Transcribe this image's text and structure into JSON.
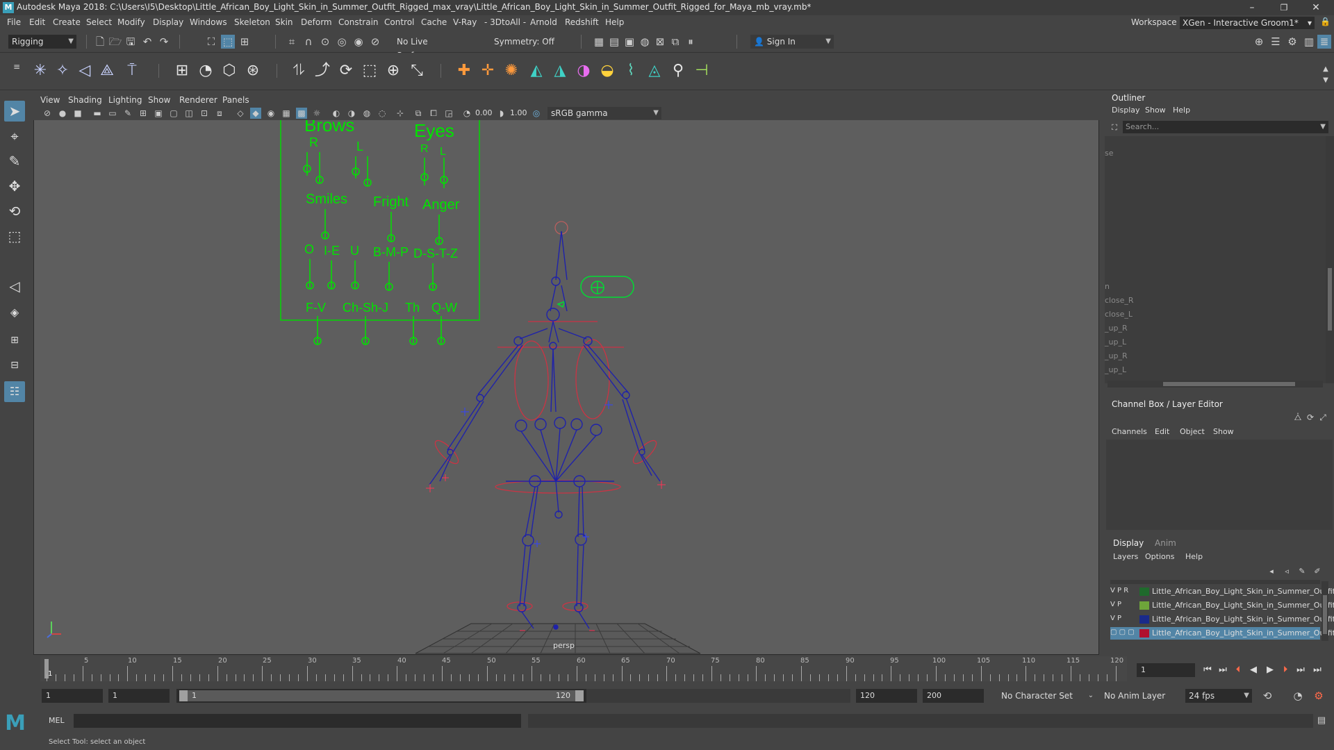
{
  "window": {
    "title": "Autodesk Maya 2018: C:\\Users\\I5\\Desktop\\Little_African_Boy_Light_Skin_in_Summer_Outfit_Rigged_max_vray\\Little_African_Boy_Light_Skin_in_Summer_Outfit_Rigged_for_Maya_mb_vray.mb*",
    "logo": "M",
    "minimize": "–",
    "maximize": "❐",
    "close": "✕"
  },
  "menubar": {
    "items": [
      "File",
      "Edit",
      "Create",
      "Select",
      "Modify",
      "Display",
      "Windows",
      "Skeleton",
      "Skin",
      "Deform",
      "Constrain",
      "Control",
      "Cache",
      "V-Ray",
      "- 3DtoAll -",
      "Arnold",
      "Redshift",
      "Help"
    ],
    "workspace_label": "Workspace :",
    "workspace_value": "XGen - Interactive Groom1*"
  },
  "statusline": {
    "menuset": "Rigging",
    "live_surface": "No Live Surface",
    "symmetry": "Symmetry: Off",
    "sign_in": "Sign In"
  },
  "viewport": {
    "menus": [
      "View",
      "Shading",
      "Lighting",
      "Show",
      "Renderer",
      "Panels"
    ],
    "exposure": "0.00",
    "gamma": "1.00",
    "color_space": "sRGB gamma",
    "camera_label": "persp"
  },
  "face_controls": {
    "brows": "Brows",
    "eyes": "Eyes",
    "brows_r": "R",
    "brows_l": "L",
    "eyes_r": "R",
    "eyes_l": "L",
    "smiles": "Smiles",
    "fright": "Fright",
    "anger": "Anger",
    "o": "O",
    "i_e": "I-E",
    "u": "U",
    "bmp": "B-M-P",
    "dstz": "D-S-T-Z",
    "fv": "F-V",
    "chshj": "Ch-Sh-J",
    "th": "Th",
    "qw": "Q-W"
  },
  "outliner": {
    "title": "Outliner",
    "menus": [
      "Display",
      "Show",
      "Help"
    ],
    "search_placeholder": "Search...",
    "items": [
      "se",
      "n",
      "close_R",
      "close_L",
      "_up_R",
      "_up_L",
      "_up_R",
      "_up_L"
    ]
  },
  "channelbox": {
    "title": "Channel Box / Layer Editor",
    "menus": [
      "Channels",
      "Edit",
      "Object",
      "Show"
    ]
  },
  "layereditor": {
    "tabs": [
      "Display",
      "Anim"
    ],
    "menus": [
      "Layers",
      "Options",
      "Help"
    ],
    "layers": [
      {
        "v": "V",
        "p": "P",
        "r": "R",
        "color": "#1f6a2c",
        "name": "Little_African_Boy_Light_Skin_in_Summer_Outfit"
      },
      {
        "v": "V",
        "p": "P",
        "r": "",
        "color": "#6ea53a",
        "name": "Little_African_Boy_Light_Skin_in_Summer_Outfit"
      },
      {
        "v": "V",
        "p": "P",
        "r": "",
        "color": "#1a2a8a",
        "name": "Little_African_Boy_Light_Skin_in_Summer_Outfit"
      },
      {
        "v": "",
        "p": "",
        "r": "",
        "color": "#b0102e",
        "name": "Little_African_Boy_Light_Skin_in_Summer_Outfit"
      }
    ]
  },
  "timeslider": {
    "labels": [
      "1",
      "5",
      "10",
      "15",
      "20",
      "25",
      "30",
      "35",
      "40",
      "45",
      "50",
      "55",
      "60",
      "65",
      "70",
      "75",
      "80",
      "85",
      "90",
      "95",
      "100",
      "105",
      "110",
      "115",
      "120"
    ],
    "current_frame": "1"
  },
  "range": {
    "start": "1",
    "playback_start": "1",
    "slider_start": "1",
    "slider_end": "120",
    "playback_end": "120",
    "end": "200",
    "character_set": "No Character Set",
    "anim_layer": "No Anim Layer",
    "fps": "24 fps"
  },
  "cmdline": {
    "lang": "MEL",
    "help_text": "Select Tool: select an object"
  }
}
